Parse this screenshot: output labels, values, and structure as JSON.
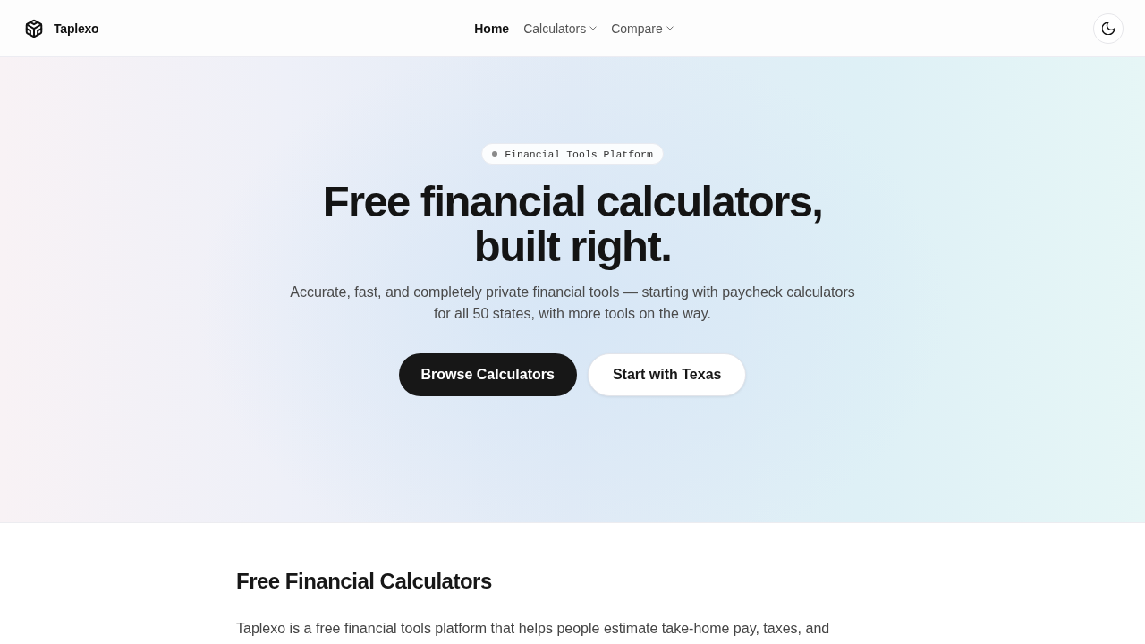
{
  "header": {
    "logo": "Taplexo",
    "nav": [
      {
        "label": "Home",
        "selected": true,
        "dropdown": false
      },
      {
        "label": "Calculators",
        "selected": false,
        "dropdown": true
      },
      {
        "label": "Compare",
        "selected": false,
        "dropdown": true
      }
    ]
  },
  "hero": {
    "badge": "Financial Tools Platform",
    "title_lines": [
      "Free financial calculators,",
      "built right."
    ],
    "subtitle": "Accurate, fast, and completely private financial tools — starting with paycheck calculators for all 50 states, with more tools on the way.",
    "buttons": [
      {
        "label": "Browse Calculators",
        "kind": "primary"
      },
      {
        "label": "Start with Texas",
        "kind": "secondary"
      }
    ]
  },
  "section": {
    "heading": "Free Financial Calculators",
    "paragraph": "Taplexo is a free financial tools platform that helps people estimate take-home pay, taxes, and"
  }
}
